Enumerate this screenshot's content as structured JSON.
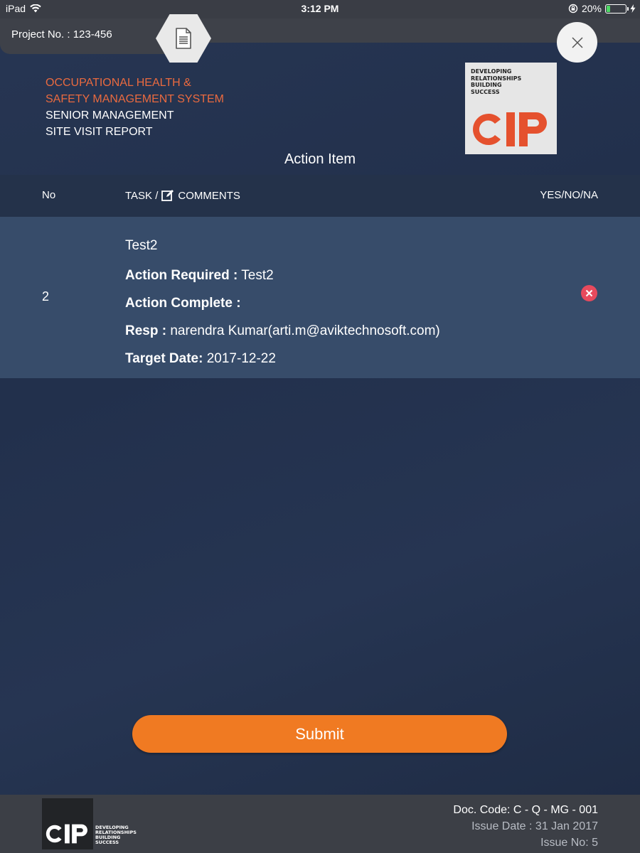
{
  "status_bar": {
    "device": "iPad",
    "time": "3:12 PM",
    "battery_percent": "20%",
    "battery_level": 0.2
  },
  "top_bar": {
    "project_label": "Project No. : 123-456"
  },
  "header": {
    "title_line1": "OCCUPATIONAL HEALTH &",
    "title_line2": "SAFETY MANAGEMENT SYSTEM",
    "subtitle_line1": "SENIOR MANAGEMENT",
    "subtitle_line2": "SITE VISIT REPORT",
    "page_title": "Action Item"
  },
  "logo": {
    "tagline": [
      "DEVELOPING",
      "RELATIONSHIPS",
      "BUILDING",
      "SUCCESS"
    ],
    "wordmark": "CIP"
  },
  "table": {
    "columns": {
      "no": "No",
      "task_prefix": "TASK /",
      "task_suffix": "COMMENTS",
      "answer": "YES/NO/NA"
    },
    "rows": [
      {
        "no": "2",
        "title": "Test2",
        "action_required_label": "Action Required :",
        "action_required_value": "Test2",
        "action_complete_label": "Action Complete :",
        "action_complete_value": "",
        "resp_label": "Resp :",
        "resp_value": "narendra Kumar(arti.m@aviktechnosoft.com)",
        "target_date_label": "Target Date:",
        "target_date_value": "2017-12-22",
        "status_icon": "remove-icon"
      }
    ]
  },
  "submit_label": "Submit",
  "footer": {
    "doc_code": "Doc. Code: C - Q - MG - 001",
    "issue_date": "Issue Date : 31 Jan 2017",
    "issue_no": "Issue No: 5",
    "tagline": [
      "DEVELOPING",
      "RELATIONSHIPS",
      "BUILDING",
      "SUCCESS"
    ],
    "wordmark": "CIP"
  },
  "colors": {
    "accent_orange": "#f07a22",
    "header_orange": "#ea6a3f",
    "logo_red": "#e5512e",
    "remove_red": "#e74a5d",
    "row_bg": "#374c6a"
  }
}
